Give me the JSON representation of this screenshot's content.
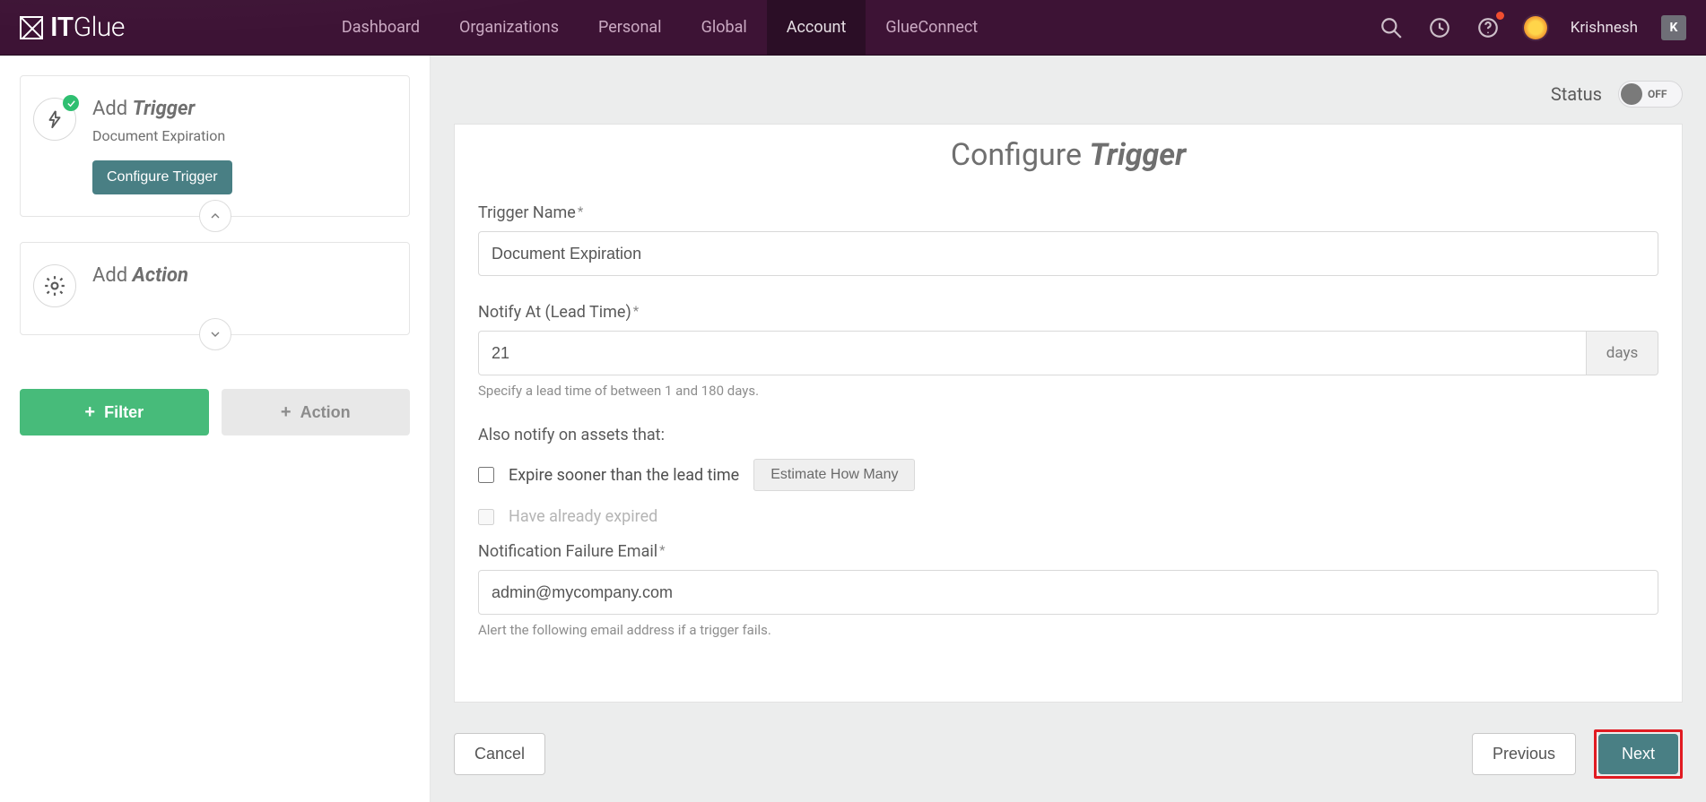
{
  "brand": {
    "name_a": "IT",
    "name_b": "Glue"
  },
  "nav": {
    "items": [
      "Dashboard",
      "Organizations",
      "Personal",
      "Global",
      "Account",
      "GlueConnect"
    ],
    "active_index": 4
  },
  "user": {
    "name": "Krishnesh",
    "initials": "K"
  },
  "status_bar": {
    "label": "Status",
    "toggle_label": "OFF"
  },
  "sidebar": {
    "trigger": {
      "title_prefix": "Add ",
      "title_em": "Trigger",
      "subtitle": "Document Expiration",
      "button": "Configure Trigger",
      "completed": true
    },
    "action": {
      "title_prefix": "Add ",
      "title_em": "Action"
    },
    "filter_btn": "Filter",
    "action_btn": "Action"
  },
  "form": {
    "title_prefix": "Configure ",
    "title_em": "Trigger",
    "trigger_name": {
      "label": "Trigger Name",
      "value": "Document Expiration"
    },
    "lead_time": {
      "label": "Notify At (Lead Time)",
      "value": "21",
      "unit": "days",
      "hint": "Specify a lead time of between 1 and 180 days."
    },
    "also_label": "Also notify on assets that:",
    "check1": "Expire sooner than the lead time",
    "check2": "Have already expired",
    "estimate_btn": "Estimate How Many",
    "fail_email": {
      "label": "Notification Failure Email",
      "value": "admin@mycompany.com",
      "hint": "Alert the following email address if a trigger fails."
    }
  },
  "footer": {
    "cancel": "Cancel",
    "previous": "Previous",
    "next": "Next"
  }
}
